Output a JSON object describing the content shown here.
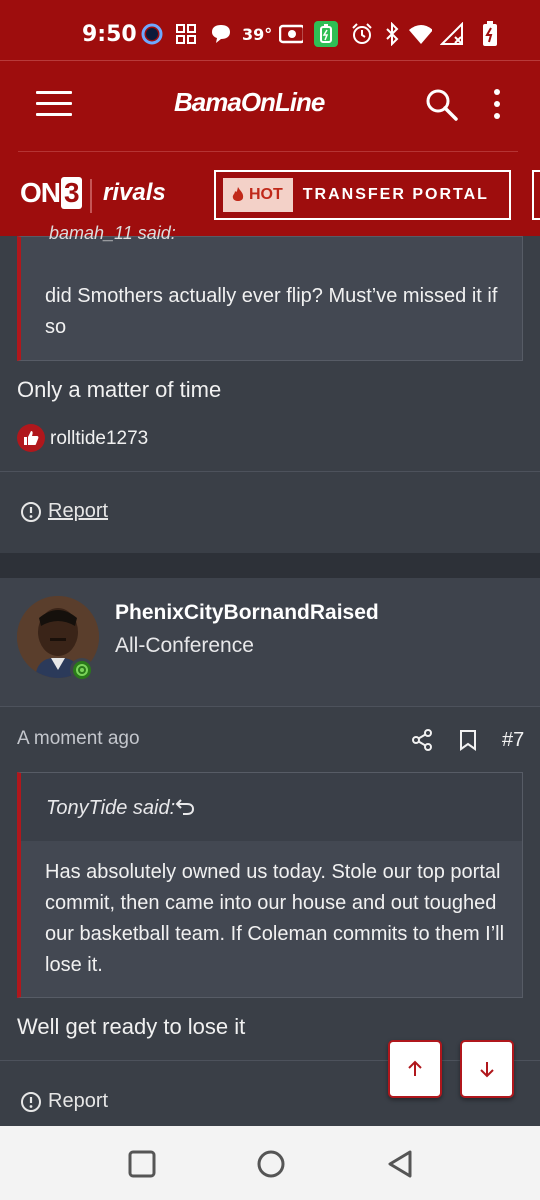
{
  "status_bar": {
    "time": "9:50",
    "temperature": "39°",
    "icons": [
      "assistant-icon",
      "grid-icon",
      "chat-bubble-icon",
      "radio-icon",
      "battery-saver-icon",
      "alarm-icon",
      "bluetooth-icon",
      "wifi-icon",
      "signal-icon",
      "battery-icon"
    ]
  },
  "header": {
    "logo": "BamaOnLine",
    "brand_on3": "ON",
    "brand_on3_num": "3",
    "brand_rivals": "rivals",
    "hot_label": "HOT",
    "portal_label": "TRANSFER PORTAL"
  },
  "post_prev": {
    "quote_author_partial": "bamah_11 said:",
    "quote_text": "did Smothers actually ever flip? Must’ve missed it if so",
    "reply_text": "Only a matter of time",
    "liked_by": "rolltide1273",
    "report_label": "Report"
  },
  "post": {
    "username": "PhenixCityBornandRaised",
    "user_title": "All-Conference",
    "time": "A moment ago",
    "post_number": "#7",
    "quote_author": "TonyTide said:",
    "quote_text": "Has absolutely owned us today. Stole our top portal commit, then came into our house and out toughed our basketball team. If Coleman commits to them I’ll lose it.",
    "reply_text": "Well get ready to lose it",
    "report_label": "Report"
  },
  "colors": {
    "brand_red": "#9e0d0d",
    "accent_red": "#b0171c",
    "background": "#3a3f47"
  }
}
